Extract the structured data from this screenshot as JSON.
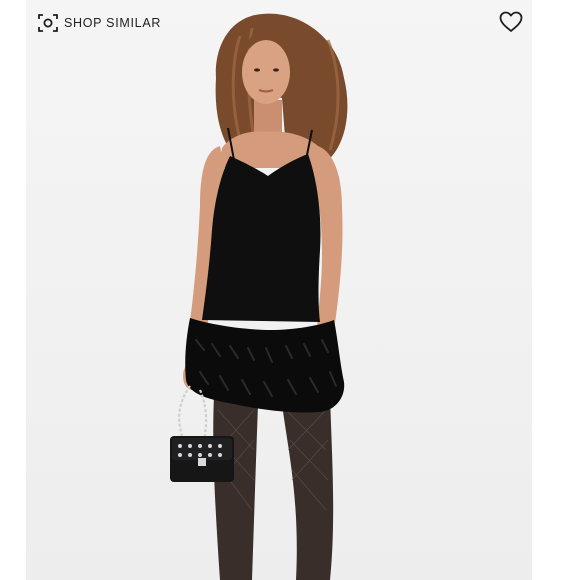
{
  "toolbar": {
    "shop_similar_label": "SHOP SIMILAR",
    "shop_similar_icon": "visual-search-icon",
    "favorite_icon": "heart-outline-icon"
  },
  "product_image": {
    "subject": "model-wearing-black-feather-trim-slip-dress",
    "accessory_icon": "studded-crossbody-bag"
  },
  "colors": {
    "background": "#f3f3f3",
    "dress": "#0f0f10",
    "skin": "#d9a282",
    "hair": "#7a4a2c",
    "bag": "#161616",
    "stud": "#d8d8d8"
  }
}
